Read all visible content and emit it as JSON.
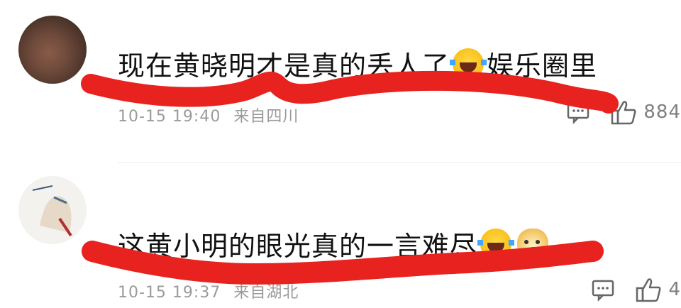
{
  "comments": [
    {
      "text": "现在黄晓明才是真的丢人了",
      "text_suffix": "娱乐圈里",
      "emojis": [
        "laugh-emoji"
      ],
      "time": "10-15 19:40",
      "location": "来自四川",
      "likes": "884"
    },
    {
      "text": "这黄小明的眼光真的一言难尽",
      "emojis": [
        "laugh-emoji",
        "doge-emoji"
      ],
      "time": "10-15 19:37",
      "location": "来自湖北",
      "likes": "4"
    }
  ],
  "icons": {
    "reply": "reply-icon",
    "like": "thumbs-up-icon"
  },
  "colors": {
    "scribble": "#e8221f",
    "meta_text": "#9a9a9a",
    "icon_stroke": "#666666"
  }
}
